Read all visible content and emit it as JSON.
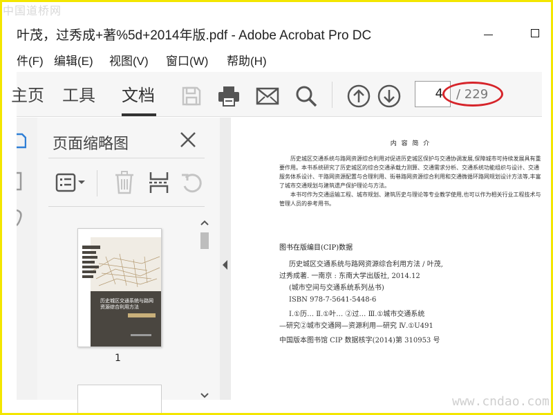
{
  "watermarks": {
    "top": "中国道桥网",
    "bottom": "www.cndao.com"
  },
  "window": {
    "title": "叶茂，过秀成+著%5d+2014年版.pdf - Adobe Acrobat Pro DC"
  },
  "menu": {
    "items": [
      "件(F)",
      "编辑(E)",
      "视图(V)",
      "窗口(W)",
      "帮助(H)"
    ]
  },
  "toolbar": {
    "tabs": [
      "主页",
      "工具",
      "文档"
    ],
    "active_tab": "文档",
    "icons": [
      "save-icon",
      "print-icon",
      "email-icon",
      "search-icon",
      "page-up-icon",
      "page-down-icon"
    ],
    "current_page": "4",
    "total_pages": "/ 229",
    "highlight_color": "#d6242a"
  },
  "panel": {
    "title": "页面缩略图",
    "tools": [
      "thumbnail-options-icon",
      "delete-icon",
      "extract-icon",
      "rotate-icon"
    ],
    "thumbnail": {
      "page_label": "1",
      "cover_title": "历史城区交通系统与路网资源综合利用方法",
      "cover_author": "叶茂 过秀成 著",
      "cover_series": "城市空间与交通系统系列丛书",
      "cover_publisher": "东南大学出版社"
    }
  },
  "document": {
    "intro_heading": "内 容 简 介",
    "intro_para1": "历史城区交通系统与路网资源综合利用对促进历史城区保护与交通协调发展,保障城市可持续发展具有重要作用。本书系统研究了历史城区的综合交通承载力测算、交通需求分析、交通系统功能组织与设计、交通服务体系设计、干路网资源配置与合理利用、街巷路网资源综合利用和交通微循环路网规划设计方法等,丰富了城市交通规划与建筑遗产保护理论与方法。",
    "intro_para2": "本书可作为交通运输工程、城市规划、建筑历史与理论等专业教学使用,也可以作为相关行业工程技术与管理人员的参考用书。",
    "cip_title": "图书在版编目(CIP)数据",
    "cip_lines": [
      "历史城区交通系统与路网资源综合利用方法 / 叶茂,",
      "过秀成著. 一南京 : 东南大学出版社, 2014.12",
      "(城市空间与交通系统系列丛书)",
      "ISBN 978-7-5641-5448-6",
      "Ⅰ.①历…  Ⅱ.①叶… ②过…  Ⅲ.①城市交通系统",
      "—研究②城市交通网—资源利用—研究  Ⅳ.①U491",
      "中国版本图书馆 CIP 数据核字(2014)第 310953 号"
    ]
  }
}
